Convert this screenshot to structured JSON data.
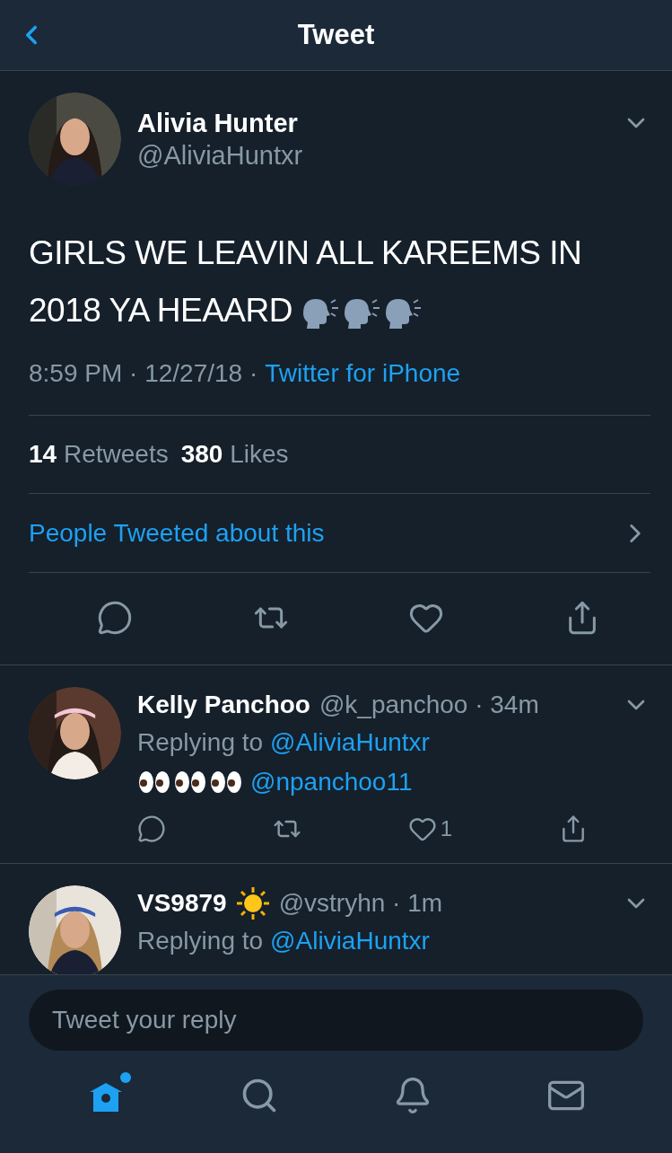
{
  "header": {
    "title": "Tweet"
  },
  "tweet": {
    "name": "Alivia Hunter",
    "handle": "@AliviaHuntxr",
    "text": "GIRLS WE LEAVIN ALL KAREEMS IN 2018 YA HEAARD",
    "time": "8:59 PM · 12/27/18 ·",
    "source": "Twitter for iPhone",
    "retweets_count": "14",
    "retweets_label": "Retweets",
    "likes_count": "380",
    "likes_label": "Likes"
  },
  "people_link": "People Tweeted about this",
  "replies": [
    {
      "kind": "emoji-mention",
      "name": "Kelly Panchoo",
      "meta": "@k_panchoo · 34m",
      "replying_label": "Replying to",
      "replying_to": "@AliviaHuntxr",
      "mention": "@npanchoo11",
      "like_count": "1",
      "actions_visible": true
    },
    {
      "kind": "emoji-name",
      "name": "VS9879",
      "meta": "@vstryhn · 1m",
      "replying_label": "Replying to",
      "replying_to": "@AliviaHuntxr",
      "actions_visible": false
    }
  ],
  "composer": {
    "placeholder": "Tweet your reply"
  },
  "tab_bar": [
    {
      "kind": "home",
      "selected": true,
      "dot": true
    },
    {
      "kind": "search",
      "selected": false,
      "dot": false
    },
    {
      "kind": "notifications",
      "selected": false,
      "dot": false
    },
    {
      "kind": "messages",
      "selected": false,
      "dot": false
    }
  ]
}
